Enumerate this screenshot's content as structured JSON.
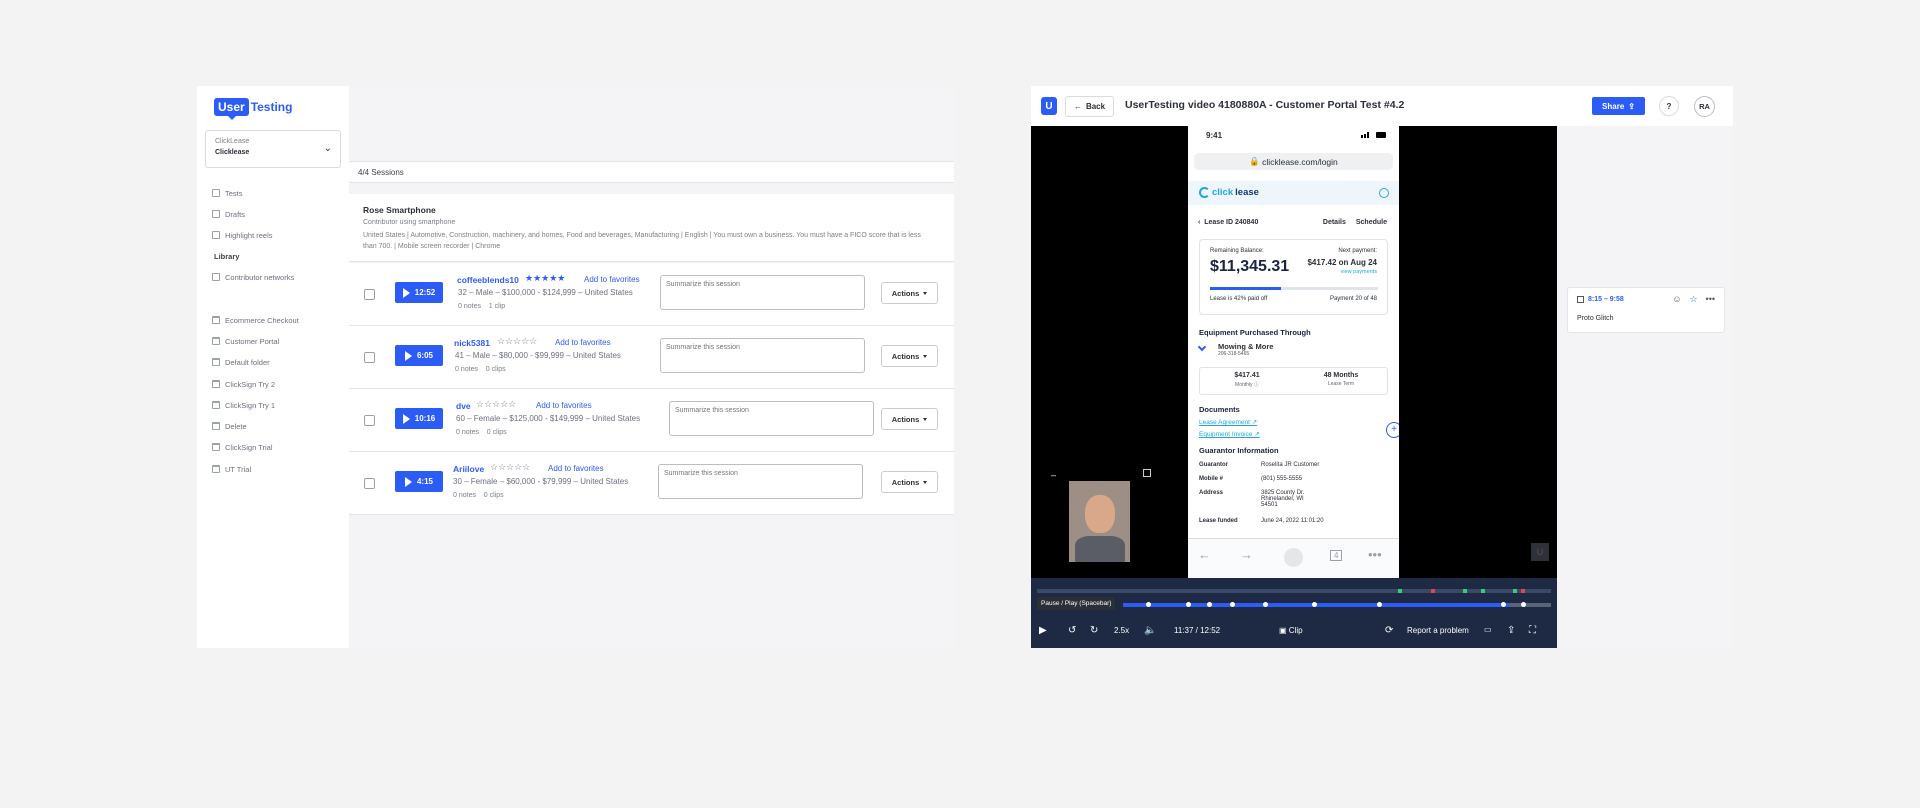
{
  "left": {
    "logo": {
      "user": "User",
      "testing": "Testing"
    },
    "workspace": {
      "label": "ClickLease",
      "name": "Clicklease"
    },
    "nav": [
      {
        "label": "Tests",
        "icon": "tests-icon"
      },
      {
        "label": "Drafts",
        "icon": "drafts-icon"
      },
      {
        "label": "Highlight reels",
        "icon": "highlight-icon"
      }
    ],
    "library_heading": "Library",
    "library_items": [
      {
        "label": "Contributor networks",
        "icon": "people-icon"
      }
    ],
    "folders": [
      "Ecommerce Checkout",
      "Customer Portal",
      "Default folder",
      "ClickSign Try 2",
      "ClickSign Try 1",
      "Delete",
      "ClickSign Trial",
      "UT Trial"
    ],
    "sessions_count": "4/4 Sessions",
    "contributor": {
      "name": "Rose Smartphone",
      "sub": "Contributor using smartphone",
      "requirements": "United States | Automotive, Construction, machinery, and homes, Food and beverages, Manufacturing | English | You must own a business. You must have a FICO score that is less than 700. | Mobile screen recorder | Chrome"
    },
    "sessions": [
      {
        "duration": "12:52",
        "user": "coffeeblends10",
        "stars": "★★★★★",
        "rated": true,
        "fav": "Add to favorites",
        "demo": "32 – Male – $100,000 - $124,999 – United States",
        "notes": "0 notes",
        "clips": "1 clip",
        "placeholder": "Summarize this session",
        "actions": "Actions"
      },
      {
        "duration": "6:05",
        "user": "nick5381",
        "stars": "☆☆☆☆☆",
        "rated": false,
        "fav": "Add to favorites",
        "demo": "41 – Male – $80,000 - $99,999 – United States",
        "notes": "0 notes",
        "clips": "0 clips",
        "placeholder": "Summarize this session",
        "actions": "Actions"
      },
      {
        "duration": "10:16",
        "user": "dve",
        "stars": "☆☆☆☆☆",
        "rated": false,
        "fav": "Add to favorites",
        "demo": "60 – Female – $125,000 - $149,999 – United States",
        "notes": "0 notes",
        "clips": "0 clips",
        "placeholder": "Summarize this session",
        "actions": "Actions"
      },
      {
        "duration": "4:15",
        "user": "Ariilove",
        "stars": "☆☆☆☆☆",
        "rated": false,
        "fav": "Add to favorites",
        "demo": "30 – Female – $60,000 - $79,999 – United States",
        "notes": "0 notes",
        "clips": "0 clips",
        "placeholder": "Summarize this session",
        "actions": "Actions"
      }
    ]
  },
  "right": {
    "logo": "U",
    "back": "Back",
    "title": "UserTesting video 4180880A - Customer Portal Test #4.2",
    "share": "Share",
    "help": "?",
    "avatar": "RA",
    "phone": {
      "time": "9:41",
      "url": "clicklease.com/login",
      "brand_click": "click",
      "brand_lease": "lease",
      "lease_id": "Lease ID 240840",
      "tab_details": "Details",
      "tab_schedule": "Schedule",
      "remaining_label": "Remaining Balance:",
      "remaining_value": "$11,345.31",
      "next_label": "Next payment:",
      "next_value": "$417.42 on Aug 24",
      "view_payments": "view payments",
      "paid_off": "Lease is 42% paid off",
      "paid_off_fraction": 0.42,
      "payment_count": "Payment 20 of 48",
      "equipment_heading": "Equipment Purchased Through",
      "vendor": "Mowing & More",
      "vendor_phone": "206-318-5465",
      "monthly_value": "$417.41",
      "monthly_label": "Monthly ⓘ",
      "term_value": "48 Months",
      "term_label": "Lease Term",
      "documents_heading": "Documents",
      "doc1": "Lease Agreement",
      "doc2": "Equipment Invoice",
      "guarantor_heading": "Guarantor Information",
      "rows": [
        {
          "k": "Guarantor",
          "v": "Roselita JR Customer"
        },
        {
          "k": "Mobile #",
          "v": "(801) 555-5555"
        },
        {
          "k": "Address",
          "v": "3825 County Dr. Rhinelander, WI 54501"
        },
        {
          "k": "Lease funded",
          "v": "June 24, 2022 11:01:20"
        }
      ],
      "tab_count": "4"
    },
    "controls": {
      "tooltip": "Pause / Play (Spacebar)",
      "speed": "2.5x",
      "time": "11:37 / 12:52",
      "clip": "Clip",
      "report": "Report a problem"
    },
    "note": {
      "time": "8:15 – 9:58",
      "title": "Proto Glitch"
    }
  }
}
